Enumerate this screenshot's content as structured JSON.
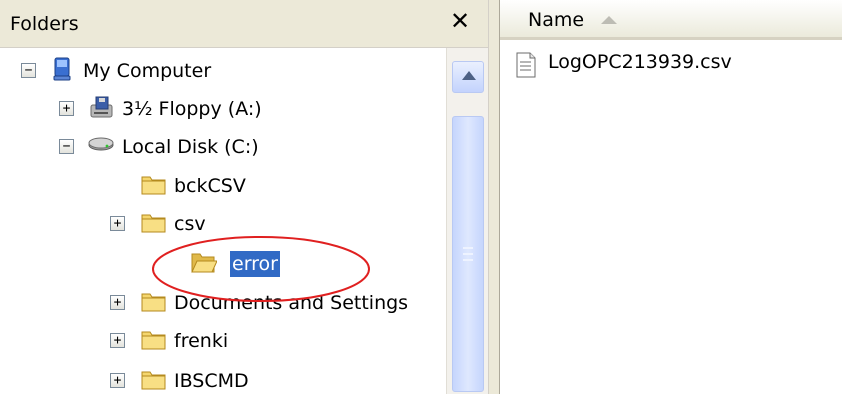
{
  "folders_pane": {
    "title": "Folders",
    "close_glyph": "✕"
  },
  "tree": {
    "items": [
      {
        "label": "My Computer",
        "icon": "computer-icon",
        "expander": "−",
        "level": 0
      },
      {
        "label": "3½ Floppy (A:)",
        "icon": "floppy-drive-icon",
        "expander": "+",
        "level": 1
      },
      {
        "label": "Local Disk (C:)",
        "icon": "hard-disk-icon",
        "expander": "−",
        "level": 1
      },
      {
        "label": "bckCSV",
        "icon": "folder-icon",
        "expander": "",
        "level": 2
      },
      {
        "label": "csv",
        "icon": "folder-icon",
        "expander": "+",
        "level": 2
      },
      {
        "label": "error",
        "icon": "folder-open-icon",
        "expander": "",
        "level": 3,
        "selected": true
      },
      {
        "label": "Documents and Settings",
        "icon": "folder-icon",
        "expander": "+",
        "level": 2
      },
      {
        "label": "frenki",
        "icon": "folder-icon",
        "expander": "+",
        "level": 2
      },
      {
        "label": "IBSCMD",
        "icon": "folder-icon",
        "expander": "+",
        "level": 2
      }
    ]
  },
  "file_list": {
    "columns": [
      {
        "label": "Name",
        "sort": "ascending"
      }
    ],
    "files": [
      {
        "name": "LogOPC213939.csv",
        "icon": "text-file-icon"
      }
    ]
  },
  "colors": {
    "selection": "#316ac5",
    "annotation": "#e02020",
    "folder": "#f5d66e",
    "pane_header": "#ece9d8"
  }
}
